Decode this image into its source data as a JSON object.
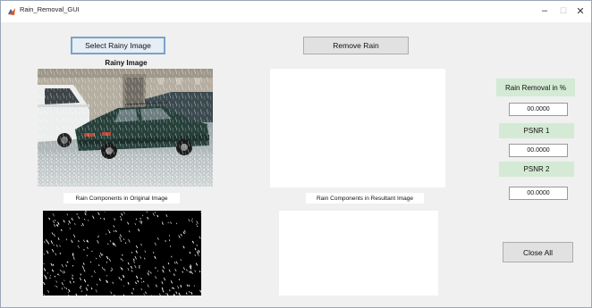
{
  "window": {
    "title": "Rain_Removal_GUI",
    "icon": "matlab-icon"
  },
  "controls": {
    "minimize": "–",
    "maximize": "☐",
    "close": "✕"
  },
  "buttons": {
    "select_image": "Select Rainy Image",
    "remove_rain": "Remove Rain",
    "close_all": "Close All"
  },
  "labels": {
    "rainy_image": "Rainy Image",
    "rain_components_original": "Rain Components in Original Image",
    "rain_components_resultant": "Rain Components in Resultant Image",
    "rain_removal": "Rain Removal in %",
    "psnr1": "PSNR 1",
    "psnr2": "PSNR 2"
  },
  "values": {
    "rain_removal": "00.0000",
    "psnr1": "00.0000",
    "psnr2": "00.0000"
  },
  "colors": {
    "label_green": "#d4ead4",
    "focus_border": "#7ba3c7"
  }
}
